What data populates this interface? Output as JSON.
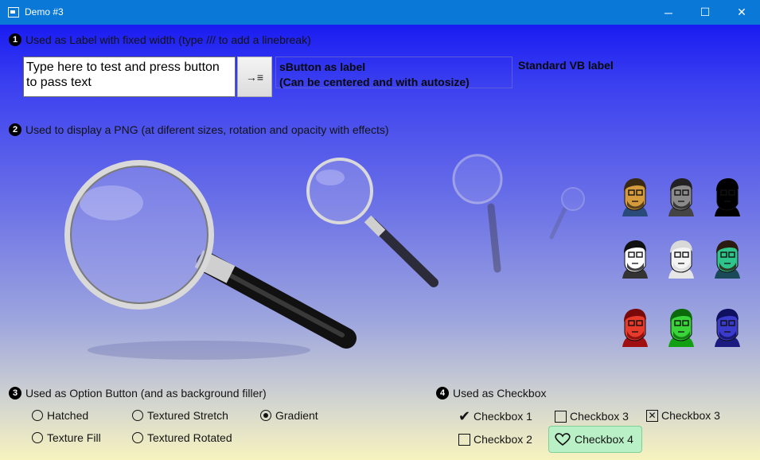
{
  "window": {
    "title": "Demo #3",
    "minimize_label": "─",
    "maximize_label": "☐",
    "close_label": "✕"
  },
  "section1": {
    "number": "1",
    "title": "Used as Label with fixed width (type /// to add a linebreak)",
    "textbox_value": "Type here to test and press button\nto pass text",
    "pass_button_icon": "→≡",
    "sbutton_label": "sButton as label\n(Can be centered and with autosize)",
    "vb_label": "Standard VB label"
  },
  "section2": {
    "number": "2",
    "title": "Used to display a PNG  (at diferent sizes,  rotation and opacity with effects)"
  },
  "section3": {
    "number": "3",
    "title": "Used as Option Button (and as background filler)",
    "options": [
      {
        "label": "Hatched",
        "selected": false
      },
      {
        "label": "Textured Stretch",
        "selected": false
      },
      {
        "label": "Gradient",
        "selected": true
      },
      {
        "label": "Texture Fill",
        "selected": false
      },
      {
        "label": "Textured Rotated",
        "selected": false
      }
    ]
  },
  "section4": {
    "number": "4",
    "title": "Used as Checkbox",
    "checkboxes": [
      {
        "label": "Checkbox 1",
        "state": "checked"
      },
      {
        "label": "Checkbox 3",
        "state": "unchecked"
      },
      {
        "label": "Checkbox 3",
        "state": "crossed"
      },
      {
        "label": "Checkbox 2",
        "state": "unchecked"
      },
      {
        "label": "Checkbox 4",
        "state": "heart"
      }
    ]
  },
  "faces": [
    {
      "skin": "#d49a3c",
      "hair": "#3a2a14",
      "shirt": "#2a4a7a"
    },
    {
      "skin": "#8a8a8a",
      "hair": "#222222",
      "shirt": "#444444"
    },
    {
      "skin": "#000000",
      "hair": "#000000",
      "shirt": "#000000"
    },
    {
      "skin": "#ffffff",
      "hair": "#111111",
      "shirt": "#333333"
    },
    {
      "skin": "#f4f4f4",
      "hair": "#d8d8d8",
      "shirt": "#e6e6e6"
    },
    {
      "skin": "#2ec48a",
      "hair": "#2a1a10",
      "shirt": "#1a4a5a"
    },
    {
      "skin": "#e83a2a",
      "hair": "#7a0a0a",
      "shirt": "#a01010"
    },
    {
      "skin": "#3ad43a",
      "hair": "#0a6a0a",
      "shirt": "#12a012"
    },
    {
      "skin": "#3a3acb",
      "hair": "#101060",
      "shirt": "#1a1a80"
    }
  ]
}
